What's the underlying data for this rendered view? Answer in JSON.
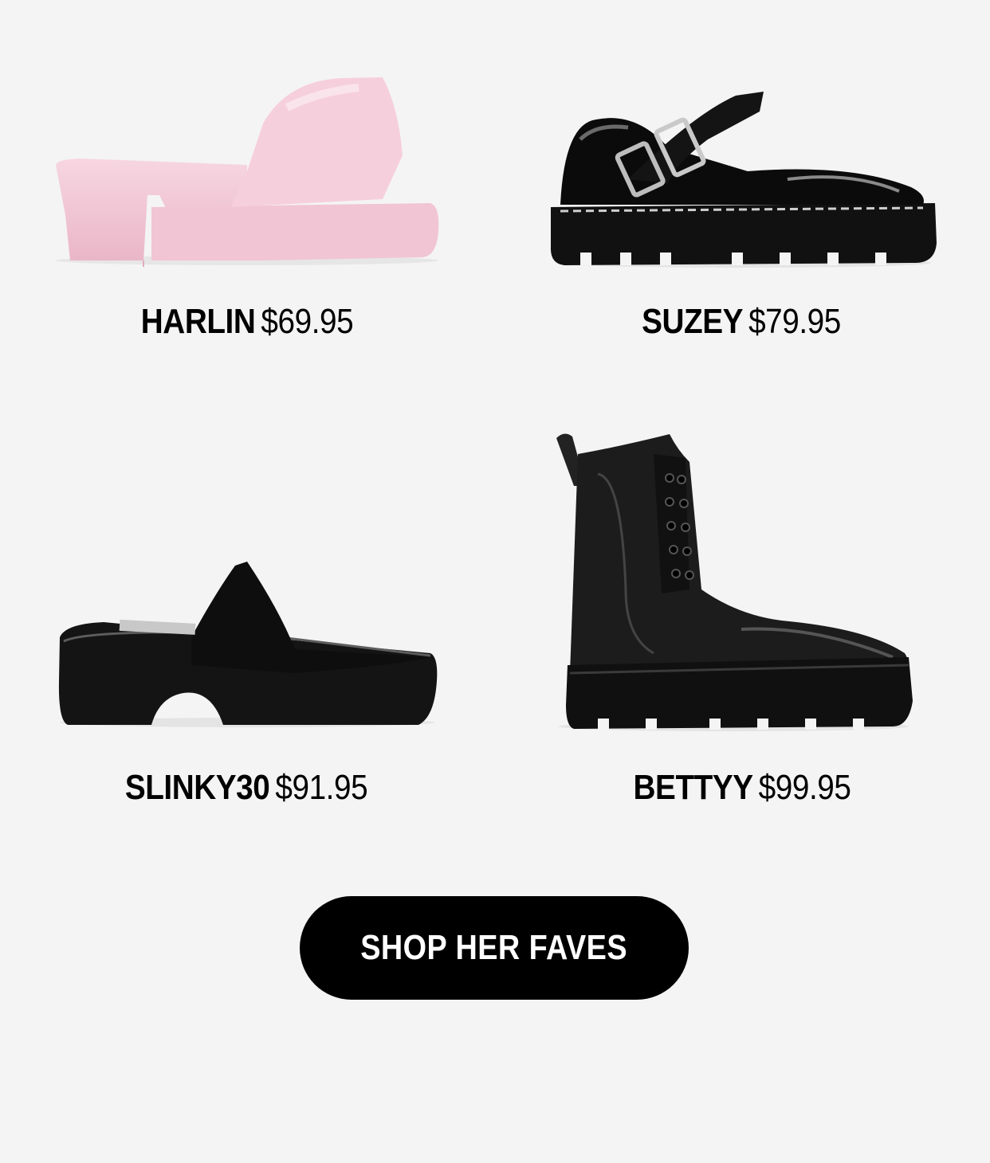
{
  "products": [
    {
      "name": "HARLIN",
      "price": "$69.95",
      "image": "pink-heeled-slide-sandal",
      "color": "#f3c7d6"
    },
    {
      "name": "SUZEY",
      "price": "$79.95",
      "image": "black-patent-mary-jane-loafer",
      "color": "#0d0d0d"
    },
    {
      "name": "SLINKY30",
      "price": "$91.95",
      "image": "black-platform-slide-sandal",
      "color": "#141414"
    },
    {
      "name": "BETTYY",
      "price": "$99.95",
      "image": "black-lace-up-platform-combat-boot",
      "color": "#1a1a1a"
    }
  ],
  "cta": {
    "label": "SHOP HER FAVES"
  }
}
